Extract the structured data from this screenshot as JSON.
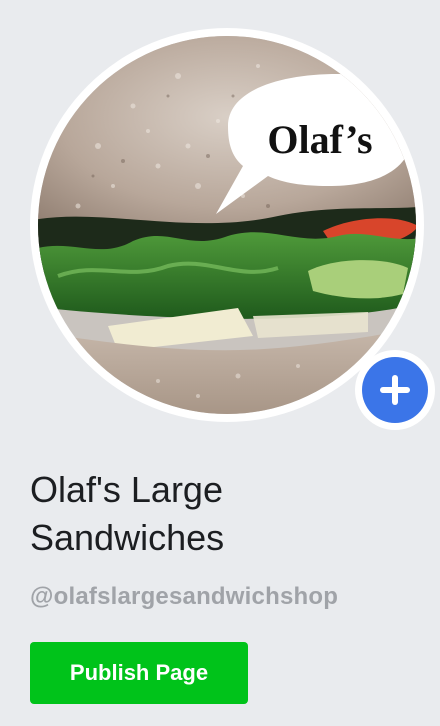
{
  "profile": {
    "speech_bubble_text": "Olaf’s",
    "add_photo_icon": "plus-icon",
    "name": "Olaf's Large Sandwiches",
    "handle": "@olafslargesandwichshop"
  },
  "actions": {
    "publish_label": "Publish Page"
  },
  "colors": {
    "background": "#e9ebee",
    "publish_button": "#00c31a",
    "add_photo_button": "#3b75e8",
    "handle_text": "#a0a3a8"
  }
}
